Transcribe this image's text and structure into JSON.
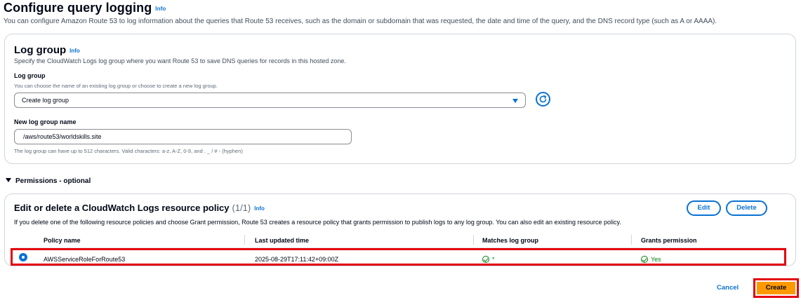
{
  "page": {
    "title": "Configure query logging",
    "info": "Info",
    "description": "You can configure Amazon Route 53 to log information about the queries that Route 53 receives, such as the domain or subdomain that was requested, the date and time of the query, and the DNS record type (such as A or AAAA)."
  },
  "log_group": {
    "title": "Log group",
    "info": "Info",
    "description": "Specify the CloudWatch Logs log group where you want Route 53 to save DNS queries for records in this hosted zone.",
    "select_label": "Log group",
    "select_hint": "You can choose the name of an existing log group or choose to create a new log group.",
    "select_value": "Create log group",
    "name_label": "New log group name",
    "name_value": "/aws/route53/worldskills.site",
    "name_hint": "The log group can have up to 512 characters. Valid characters: a-z, A-Z, 0-9, and . _ / # - (hyphen)"
  },
  "permissions": {
    "header": "Permissions - optional",
    "title": "Edit or delete a CloudWatch Logs resource policy",
    "count": "(1/1)",
    "info": "Info",
    "description": "If you delete one of the following resource policies and choose Grant permission, Route 53 creates a resource policy that grants permission to publish logs to any log group. You can also edit an existing resource policy.",
    "edit_label": "Edit",
    "delete_label": "Delete",
    "columns": [
      "Policy name",
      "Last updated time",
      "Matches log group",
      "Grants permission"
    ],
    "rows": [
      {
        "selected": true,
        "policy_name": "AWSServiceRoleForRoute53",
        "last_updated": "2025-08-29T17:11:42+09:00Z",
        "matches": "*",
        "grants": "Yes"
      }
    ]
  },
  "footer": {
    "cancel_label": "Cancel",
    "create_label": "Create"
  },
  "colors": {
    "accent": "#0972d3",
    "primary_button": "#ff9900",
    "success": "#037f0c",
    "highlight": "#e3000b"
  }
}
